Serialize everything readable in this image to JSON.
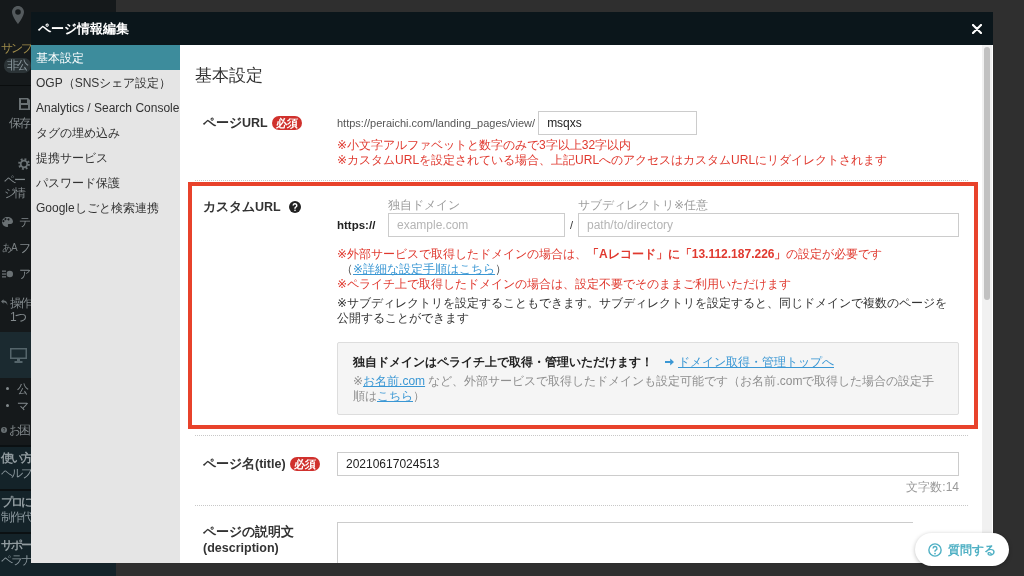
{
  "background_app": {
    "sidebar": {
      "project_name": "サンプ",
      "status_badge": "非公",
      "tools": [
        {
          "kind": "save",
          "label": "保存"
        },
        {
          "kind": "settings",
          "label": "ページ情"
        }
      ],
      "menu": [
        {
          "kind": "palette",
          "label": "テ"
        },
        {
          "kind": "glyph",
          "glyph": "あA",
          "label": "フ"
        },
        {
          "kind": "list",
          "label": "ア"
        }
      ],
      "history_lines": [
        "操作",
        "1つ"
      ],
      "bullets": [
        "公",
        "マ"
      ],
      "help": "お困",
      "panels": [
        {
          "title": "使い方",
          "subtitle": "ヘルプ"
        },
        {
          "title": "プロに",
          "subtitle": "制作代"
        },
        {
          "title": "サポー",
          "subtitle": "ペラナ"
        }
      ]
    }
  },
  "modal": {
    "title": "ページ情報編集"
  },
  "nav": [
    {
      "label": "基本設定",
      "selected": true
    },
    {
      "label": "OGP（SNSシェア設定）",
      "selected": false
    },
    {
      "label": "Analytics / Search Console",
      "selected": false
    },
    {
      "label": "タグの埋め込み",
      "selected": false
    },
    {
      "label": "提携サービス",
      "selected": false
    },
    {
      "label": "パスワード保護",
      "selected": false
    },
    {
      "label": "Googleしごと検索連携",
      "selected": false
    }
  ],
  "content": {
    "heading": "基本設定",
    "rows": [
      {
        "kind": "url",
        "label": "ページURL",
        "badge": "必須",
        "prefix": "https://peraichi.com/landing_pages/view/",
        "value": "msqxs",
        "notes": [
          {
            "kind": "warning",
            "text": "※小文字アルファベットと数字のみで3字以上32字以内"
          },
          {
            "kind": "warning",
            "text": "※カスタムURLを設定されている場合、上記URLへのアクセスはカスタムURLにリダイレクトされます"
          }
        ]
      },
      {
        "kind": "custom_url",
        "label": "カスタムURL",
        "help_icon": true,
        "highlighted": true,
        "scheme": "https://",
        "separator": "/",
        "fields": [
          {
            "caption": "独自ドメイン",
            "placeholder": "example.com"
          },
          {
            "caption": "サブディレクトリ※任意",
            "placeholder": "path/to/directory"
          }
        ],
        "notes": [
          {
            "kind": "warning",
            "text": "※外部サービスで取得したドメインの場合は、**「Aレコード」に「13.112.187.226」**の設定が必要です",
            "link_before": "（",
            "link": "※詳細な設定手順はこちら",
            "link_after": "）"
          },
          {
            "kind": "warning",
            "text": "※ペライチ上で取得したドメインの場合は、設定不要でそのままご利用いただけます"
          },
          {
            "kind": "info",
            "text": "※サブディレクトリを設定することもできます。サブディレクトリを設定すると、同じドメインで複数のページを公開することができます"
          }
        ],
        "promo": {
          "headline": "独自ドメインはペライチ上で取得・管理いただけます！",
          "link": "ドメイン取得・管理トップへ",
          "footnote": [
            {
              "kind": "text",
              "text": "※"
            },
            {
              "kind": "link",
              "text": "お名前.com"
            },
            {
              "kind": "text",
              "text": " など、外部サービスで取得したドメインも設定可能です（お名前.comで取得した場合の設定手順は"
            },
            {
              "kind": "link",
              "text": "こちら"
            },
            {
              "kind": "text",
              "text": "）"
            }
          ]
        }
      },
      {
        "kind": "text",
        "label": "ページ名(title)",
        "badge": "必須",
        "value": "20210617024513",
        "counter": "文字数:14"
      },
      {
        "kind": "textarea",
        "label_lines": [
          "ページの説明文",
          "(description)"
        ]
      }
    ]
  },
  "help_button": {
    "label": "質問する"
  }
}
